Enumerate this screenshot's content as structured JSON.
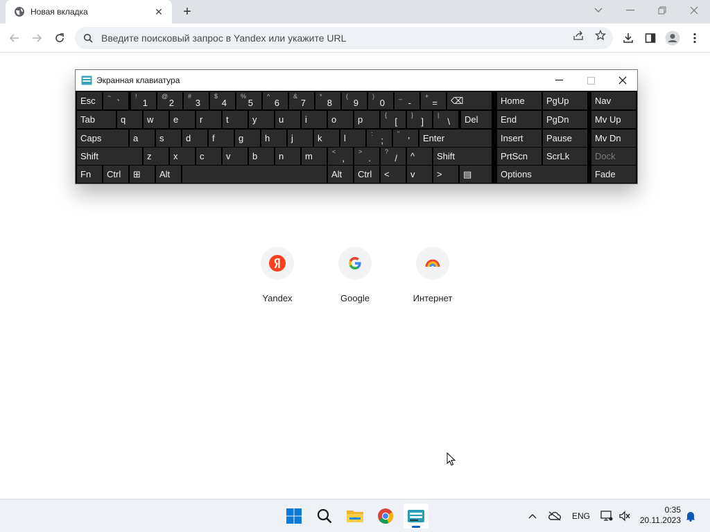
{
  "browser": {
    "tab_title": "Новая вкладка",
    "omnibox_placeholder": "Введите поисковый запрос в Yandex или укажите URL",
    "icons": [
      "globe-icon",
      "close-icon",
      "plus-icon",
      "chevron-down-icon",
      "minimize-icon",
      "restore-icon",
      "back-icon",
      "forward-icon",
      "reload-icon",
      "search-icon",
      "share-icon",
      "star-icon",
      "download-icon",
      "side-panel-icon",
      "profile-icon",
      "more-icon"
    ]
  },
  "osk": {
    "title": "Экранная клавиатура",
    "rows": [
      [
        {
          "main": "Esc"
        },
        {
          "sub": "~",
          "main": "`"
        },
        {
          "sub": "!",
          "main": "1"
        },
        {
          "sub": "@",
          "main": "2"
        },
        {
          "sub": "#",
          "main": "3"
        },
        {
          "sub": "$",
          "main": "4"
        },
        {
          "sub": "%",
          "main": "5"
        },
        {
          "sub": "^",
          "main": "6"
        },
        {
          "sub": "&",
          "main": "7"
        },
        {
          "sub": "*",
          "main": "8"
        },
        {
          "sub": "(",
          "main": "9"
        },
        {
          "sub": ")",
          "main": "0"
        },
        {
          "sub": "_",
          "main": "-"
        },
        {
          "sub": "+",
          "main": "="
        },
        {
          "main": "⌫"
        },
        {
          "main": "Home"
        },
        {
          "main": "PgUp"
        },
        {
          "main": "Nav"
        }
      ],
      [
        {
          "main": "Tab"
        },
        {
          "main": "q"
        },
        {
          "main": "w"
        },
        {
          "main": "e"
        },
        {
          "main": "r"
        },
        {
          "main": "t"
        },
        {
          "main": "y"
        },
        {
          "main": "u"
        },
        {
          "main": "i"
        },
        {
          "main": "o"
        },
        {
          "main": "p"
        },
        {
          "sub": "{",
          "main": "["
        },
        {
          "sub": "}",
          "main": "]"
        },
        {
          "sub": "|",
          "main": "\\"
        },
        {
          "main": "Del"
        },
        {
          "main": "End"
        },
        {
          "main": "PgDn"
        },
        {
          "main": "Mv Up"
        }
      ],
      [
        {
          "main": "Caps"
        },
        {
          "main": "a"
        },
        {
          "main": "s"
        },
        {
          "main": "d"
        },
        {
          "main": "f"
        },
        {
          "main": "g"
        },
        {
          "main": "h"
        },
        {
          "main": "j"
        },
        {
          "main": "k"
        },
        {
          "main": "l"
        },
        {
          "sub": ":",
          "main": ";"
        },
        {
          "sub": "\"",
          "main": "'"
        },
        {
          "main": "Enter"
        },
        {
          "main": "Insert"
        },
        {
          "main": "Pause"
        },
        {
          "main": "Mv Dn"
        }
      ],
      [
        {
          "main": "Shift"
        },
        {
          "main": "z"
        },
        {
          "main": "x"
        },
        {
          "main": "c"
        },
        {
          "main": "v"
        },
        {
          "main": "b"
        },
        {
          "main": "n"
        },
        {
          "main": "m"
        },
        {
          "sub": "<",
          "main": ","
        },
        {
          "sub": ">",
          "main": "."
        },
        {
          "sub": "?",
          "main": "/"
        },
        {
          "main": "^"
        },
        {
          "main": "Shift"
        },
        {
          "main": "PrtScn"
        },
        {
          "main": "ScrLk"
        },
        {
          "main": "Dock",
          "dim": true
        }
      ],
      [
        {
          "main": "Fn"
        },
        {
          "main": "Ctrl"
        },
        {
          "main": "⊞"
        },
        {
          "main": "Alt"
        },
        {
          "main": ""
        },
        {
          "main": "Alt"
        },
        {
          "main": "Ctrl"
        },
        {
          "main": "<"
        },
        {
          "main": "v"
        },
        {
          "main": ">"
        },
        {
          "main": "▤"
        },
        {
          "main": "Options"
        },
        {
          "main": "Fade"
        }
      ]
    ]
  },
  "shortcuts": [
    {
      "label": "Yandex",
      "icon": "yandex-logo-icon"
    },
    {
      "label": "Google",
      "icon": "google-logo-icon"
    },
    {
      "label": "Интернет",
      "icon": "rainbow-icon"
    }
  ],
  "taskbar": {
    "apps": [
      "windows-start-icon",
      "search-icon",
      "file-explorer-icon",
      "chrome-icon",
      "on-screen-keyboard-icon"
    ],
    "language": "ENG",
    "time": "0:35",
    "date": "20.11.2023"
  },
  "colors": {
    "key_bg": "#2b2b2b",
    "key_text": "#f2f2f2",
    "osk_bg": "#000000",
    "taskbar_bg": "#eef1f6",
    "accent": "#0067c0"
  }
}
